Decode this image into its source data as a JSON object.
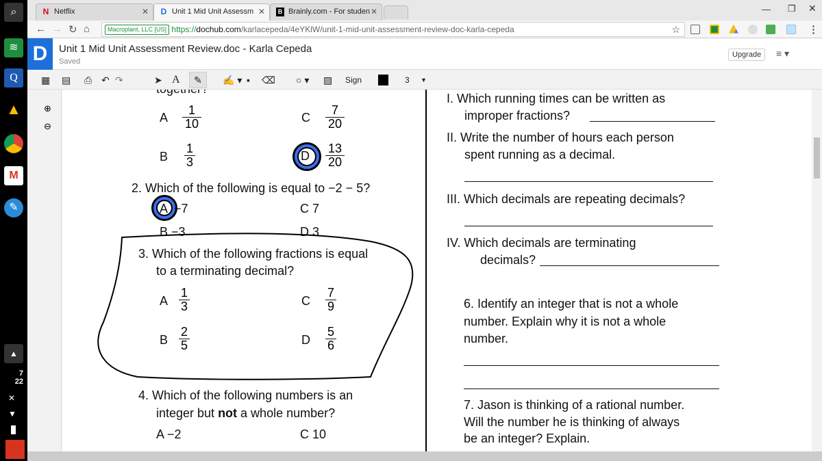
{
  "shelf": {
    "time_hour": "7",
    "time_min": "22"
  },
  "tabs": [
    {
      "label": "Netflix",
      "favicon": "N"
    },
    {
      "label": "Unit 1 Mid Unit Assessm",
      "favicon": "D"
    },
    {
      "label": "Brainly.com - For studen",
      "favicon": "B"
    }
  ],
  "address": {
    "security": "Macroplant, LLC [US]",
    "url_scheme": "https://",
    "url_domain": "dochub.com",
    "url_path": "/karlacepeda/4eYKlW/unit-1-mid-unit-assessment-review-doc-karla-cepeda"
  },
  "doc": {
    "title": "Unit 1 Mid Unit Assessment Review.doc - Karla Cepeda",
    "status": "Saved",
    "upgrade": "Upgrade"
  },
  "toolbar": {
    "sign": "Sign",
    "size": "3",
    "text_tool": "A"
  },
  "colors": {
    "accent": "#1e6fd9",
    "circle": "#3b6ef0"
  },
  "left": {
    "q1_tail": "together?",
    "q1": {
      "A": [
        "1",
        "10"
      ],
      "B": [
        "1",
        "3"
      ],
      "C": [
        "7",
        "20"
      ],
      "D": [
        "13",
        "20"
      ]
    },
    "q2": {
      "text": "2. Which of the following is equal to −2 − 5?",
      "A": "−7",
      "B": "B  −3",
      "C": "C  7",
      "D": "D  3"
    },
    "q3": {
      "line1": "3. Which of the following fractions is equal",
      "line2": "to a terminating decimal?",
      "A": [
        "1",
        "3"
      ],
      "B": [
        "2",
        "5"
      ],
      "C": [
        "7",
        "9"
      ],
      "D": [
        "5",
        "6"
      ]
    },
    "q4": {
      "line1": "4. Which of the following numbers is an",
      "line2_a": "integer but ",
      "line2_b": "not",
      "line2_c": " a whole number?",
      "A": "A  −2",
      "C": "C  10"
    },
    "letters": {
      "A": "A",
      "B": "B",
      "C": "C",
      "D": "D"
    }
  },
  "right": {
    "i": "I.  Which running times can be written as",
    "i2": "improper fractions?",
    "ii": "II.  Write the number of hours each person",
    "ii2": "spent running as a decimal.",
    "iii": "III.  Which decimals are repeating decimals?",
    "iv": "IV.  Which decimals are terminating",
    "iv2": "decimals?",
    "q6a": "6.  Identify an integer that is not a whole",
    "q6b": "number.  Explain why it is not a whole",
    "q6c": "number.",
    "q7a": "7.  Jason is thinking of a rational number.",
    "q7b": "Will the number he is thinking of always",
    "q7c": "be an integer?  Explain."
  }
}
